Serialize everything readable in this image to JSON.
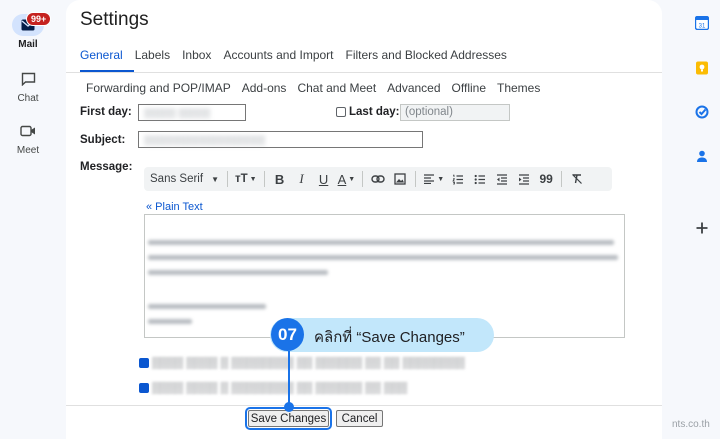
{
  "nav": {
    "mail_label": "Mail",
    "mail_badge": "99+",
    "chat_label": "Chat",
    "meet_label": "Meet"
  },
  "settings": {
    "title": "Settings",
    "tabs_row1": [
      "General",
      "Labels",
      "Inbox",
      "Accounts and Import",
      "Filters and Blocked Addresses"
    ],
    "tabs_row2": [
      "Forwarding and POP/IMAP",
      "Add-ons",
      "Chat and Meet",
      "Advanced",
      "Offline",
      "Themes"
    ],
    "active_tab": "General"
  },
  "vacation": {
    "first_day_label": "First day:",
    "last_day_label": "Last day:",
    "last_day_placeholder": "(optional)",
    "subject_label": "Subject:",
    "message_label": "Message:",
    "font_name": "Sans Serif",
    "plain_text_link": "« Plain Text",
    "contacts_only_checked": true,
    "org_only_checked": true
  },
  "buttons": {
    "save": "Save Changes",
    "cancel": "Cancel"
  },
  "annotation": {
    "step": "07",
    "text": "คลิกที่ “Save Changes”"
  },
  "watermark": "nts.co.th",
  "colors": {
    "accent": "#0b57d0",
    "annotation_bg": "#c2e7fb",
    "annotation_circle": "#1a73e8"
  }
}
